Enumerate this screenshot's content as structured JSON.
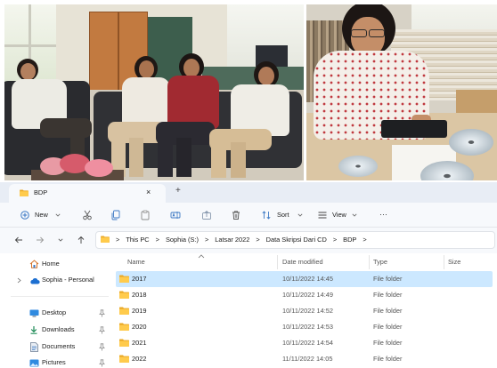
{
  "explorer": {
    "tab": {
      "title": "BDP",
      "close": "×",
      "add": "+"
    },
    "toolbar": {
      "new": "New",
      "sort": "Sort",
      "view": "View",
      "more": "···"
    },
    "address": {
      "separator": ">",
      "crumbs": [
        "This PC",
        "Sophia (S:)",
        "Latsar 2022",
        "Data Skripsi Dari CD",
        "BDP"
      ]
    },
    "nav": {
      "home": "Home",
      "cloud": "Sophia - Personal",
      "quick_access": [
        "Desktop",
        "Downloads",
        "Documents",
        "Pictures"
      ]
    },
    "columns": {
      "name": "Name",
      "date": "Date modified",
      "type": "Type",
      "size": "Size"
    },
    "rows": [
      {
        "name": "2017",
        "date": "10/11/2022 14:45",
        "type": "File folder",
        "selected": true
      },
      {
        "name": "2018",
        "date": "10/11/2022 14:49",
        "type": "File folder",
        "selected": false
      },
      {
        "name": "2019",
        "date": "10/11/2022 14:52",
        "type": "File folder",
        "selected": false
      },
      {
        "name": "2020",
        "date": "10/11/2022 14:53",
        "type": "File folder",
        "selected": false
      },
      {
        "name": "2021",
        "date": "10/11/2022 14:54",
        "type": "File folder",
        "selected": false
      },
      {
        "name": "2022",
        "date": "11/11/2022 14:05",
        "type": "File folder",
        "selected": false
      }
    ],
    "icons": [
      "folder-icon",
      "plus-circle-icon",
      "scissors-icon",
      "copy-icon",
      "paste-icon",
      "rename-icon",
      "share-icon",
      "trash-icon",
      "sort-icon",
      "view-icon",
      "back-arrow-icon",
      "forward-arrow-icon",
      "chevron-down-icon",
      "up-arrow-icon",
      "home-icon",
      "cloud-icon",
      "desktop-icon",
      "download-icon",
      "document-icon",
      "pictures-icon",
      "pin-icon"
    ]
  },
  "colors": {
    "tab-strip": "#e8edf5",
    "toolbar": "#f7f9fc",
    "selection": "#cce8ff",
    "folder": "#ffcb4c",
    "accent": "#3b78c4"
  }
}
